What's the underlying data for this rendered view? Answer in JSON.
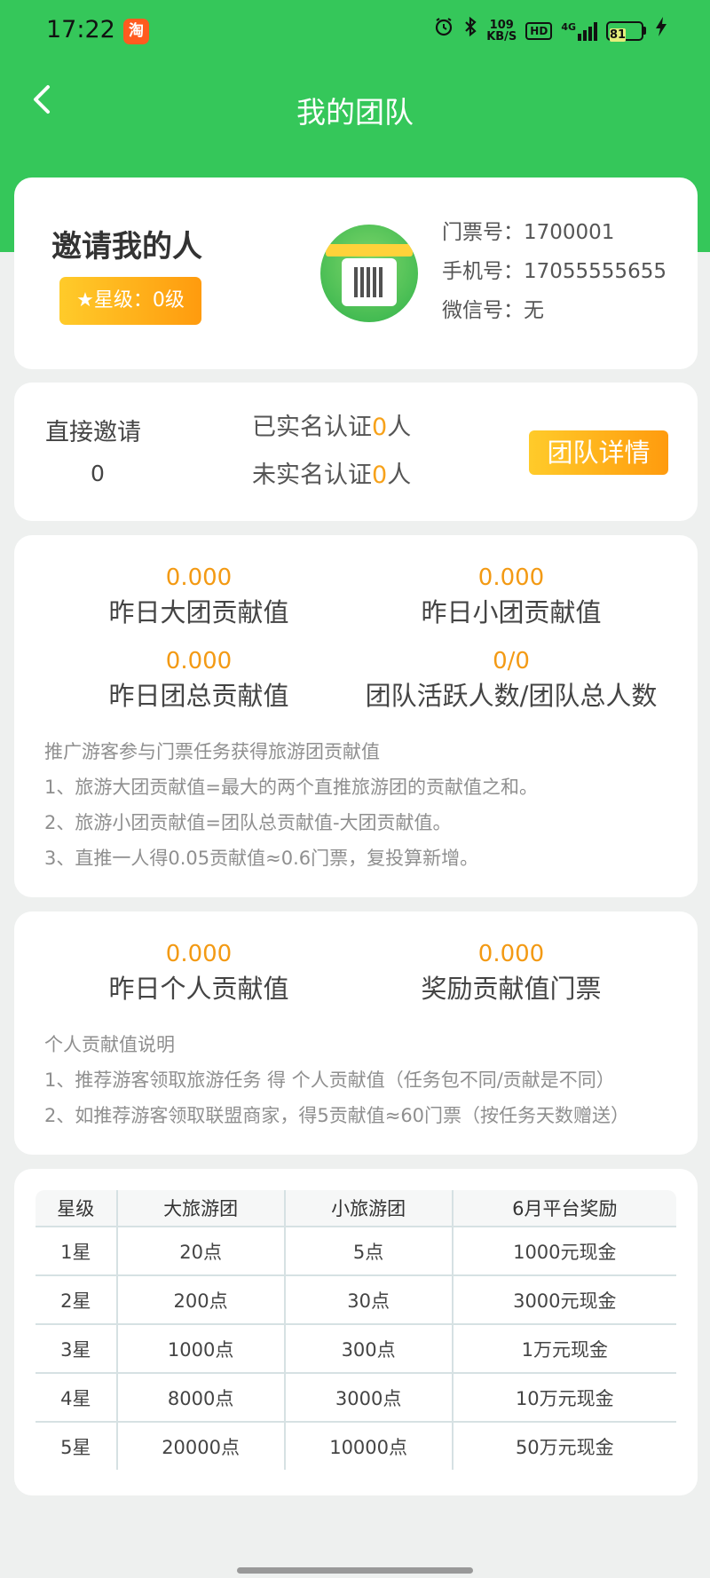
{
  "status_bar": {
    "time": "17:22",
    "app_badge": "淘",
    "net_speed_value": "109",
    "net_speed_unit": "KB/S",
    "hd": "HD",
    "network": "4G",
    "battery": "81",
    "battery_level": 0.81
  },
  "nav": {
    "title": "我的团队"
  },
  "inviter": {
    "title": "邀请我的人",
    "star_label": "★星级：0级",
    "ticket_no": "门票号：1700001",
    "phone": "手机号：17055555655",
    "wechat": "微信号：无"
  },
  "invite_summary": {
    "direct_label": "直接邀请",
    "direct_value": "0",
    "verified_prefix": "已实名认证",
    "verified_count": "0",
    "verified_suffix": "人",
    "unverified_prefix": "未实名认证",
    "unverified_count": "0",
    "unverified_suffix": "人",
    "team_detail_button": "团队详情"
  },
  "team_stats": {
    "big_team_value": "0.000",
    "big_team_label": "昨日大团贡献值",
    "small_team_value": "0.000",
    "small_team_label": "昨日小团贡献值",
    "total_value": "0.000",
    "total_label": "昨日团总贡献值",
    "active_value": "0/0",
    "active_label": "团队活跃人数/团队总人数",
    "notes": [
      "推广游客参与门票任务获得旅游团贡献值",
      "1、旅游大团贡献值=最大的两个直推旅游团的贡献值之和。",
      "2、旅游小团贡献值=团队总贡献值-大团贡献值。",
      "3、直推一人得0.05贡献值≈0.6门票，复投算新增。"
    ]
  },
  "personal_stats": {
    "personal_value": "0.000",
    "personal_label": "昨日个人贡献值",
    "reward_value": "0.000",
    "reward_label": "奖励贡献值门票",
    "notes": [
      "个人贡献值说明",
      "1、推荐游客领取旅游任务 得 个人贡献值（任务包不同/贡献是不同）",
      "2、如推荐游客领取联盟商家，得5贡献值≈60门票（按任务天数赠送）"
    ]
  },
  "reward_table": {
    "headers": [
      "星级",
      "大旅游团",
      "小旅游团",
      "6月平台奖励"
    ],
    "rows": [
      [
        "1星",
        "20点",
        "5点",
        "1000元现金"
      ],
      [
        "2星",
        "200点",
        "30点",
        "3000元现金"
      ],
      [
        "3星",
        "1000点",
        "300点",
        "1万元现金"
      ],
      [
        "4星",
        "8000点",
        "3000点",
        "10万元现金"
      ],
      [
        "5星",
        "20000点",
        "10000点",
        "50万元现金"
      ]
    ]
  },
  "colors": {
    "brand_green": "#35c75a",
    "accent_orange": "#f39a14"
  }
}
